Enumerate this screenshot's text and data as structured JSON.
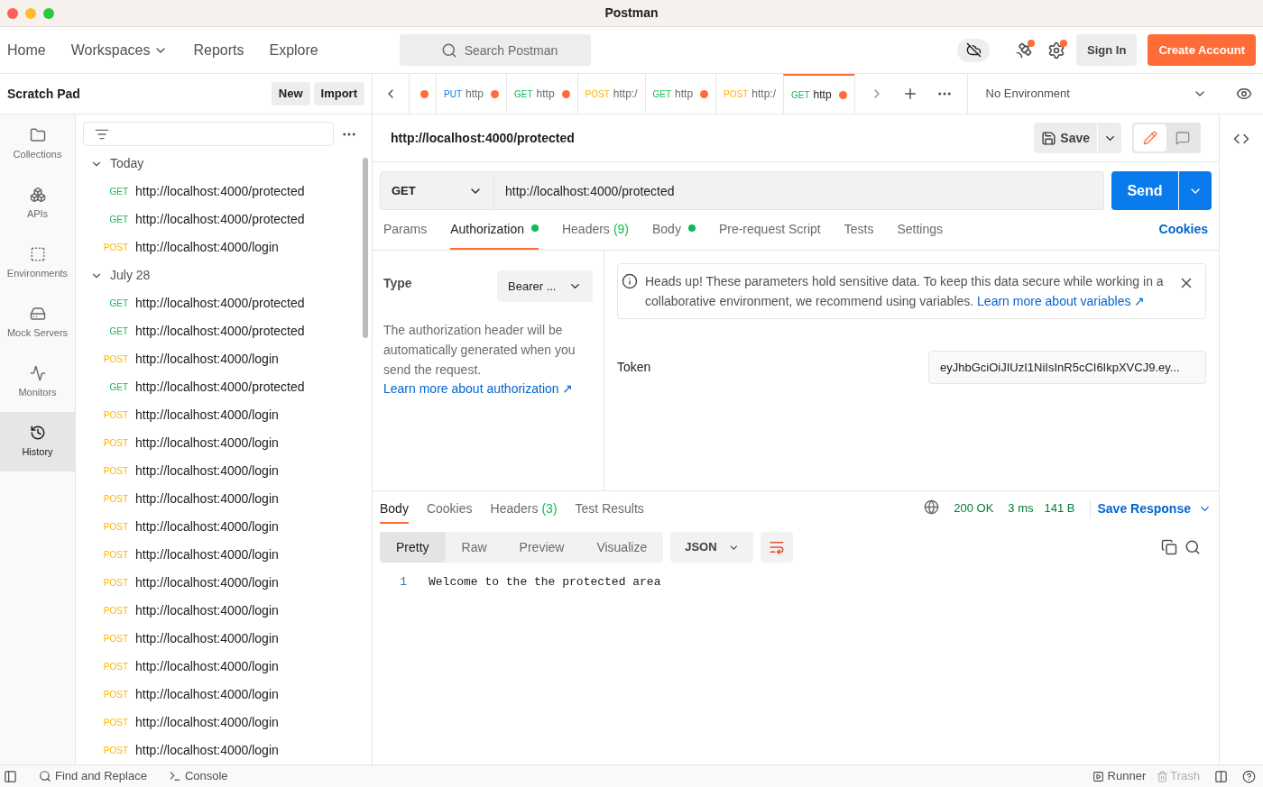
{
  "window": {
    "title": "Postman"
  },
  "nav": {
    "items": [
      {
        "label": "Home",
        "dropdown": false
      },
      {
        "label": "Workspaces",
        "dropdown": true
      },
      {
        "label": "Reports",
        "dropdown": false
      },
      {
        "label": "Explore",
        "dropdown": false
      }
    ],
    "search": {
      "placeholder": "Search Postman"
    },
    "sign_in": "Sign In",
    "create_account": "Create Account"
  },
  "scratch": {
    "title": "Scratch Pad",
    "buttons": [
      "New",
      "Import"
    ]
  },
  "rail": [
    {
      "label": "Collections",
      "kind": "collections",
      "selected": false
    },
    {
      "label": "APIs",
      "kind": "apis",
      "selected": false
    },
    {
      "label": "Environments",
      "kind": "environments",
      "selected": false
    },
    {
      "label": "Mock Servers",
      "kind": "mock",
      "selected": false
    },
    {
      "label": "Monitors",
      "kind": "monitors",
      "selected": false
    },
    {
      "label": "History",
      "kind": "history",
      "selected": true
    }
  ],
  "history": [
    {
      "label": "Today",
      "expanded": true,
      "children": [
        {
          "method": "GET",
          "color": "#0cbb52",
          "url": "http://localhost:4000/protected"
        },
        {
          "method": "GET",
          "color": "#0cbb52",
          "url": "http://localhost:4000/protected"
        },
        {
          "method": "POST",
          "color": "#ffb400",
          "url": "http://localhost:4000/login"
        }
      ]
    },
    {
      "label": "July 28",
      "expanded": true,
      "children": [
        {
          "method": "GET",
          "color": "#0cbb52",
          "url": "http://localhost:4000/protected"
        },
        {
          "method": "GET",
          "color": "#0cbb52",
          "url": "http://localhost:4000/protected"
        },
        {
          "method": "POST",
          "color": "#ffb400",
          "url": "http://localhost:4000/login"
        },
        {
          "method": "GET",
          "color": "#0cbb52",
          "url": "http://localhost:4000/protected"
        },
        {
          "method": "POST",
          "color": "#ffb400",
          "url": "http://localhost:4000/login"
        },
        {
          "method": "POST",
          "color": "#ffb400",
          "url": "http://localhost:4000/login"
        },
        {
          "method": "POST",
          "color": "#ffb400",
          "url": "http://localhost:4000/login"
        },
        {
          "method": "POST",
          "color": "#ffb400",
          "url": "http://localhost:4000/login"
        },
        {
          "method": "POST",
          "color": "#ffb400",
          "url": "http://localhost:4000/login"
        },
        {
          "method": "POST",
          "color": "#ffb400",
          "url": "http://localhost:4000/login"
        },
        {
          "method": "POST",
          "color": "#ffb400",
          "url": "http://localhost:4000/login"
        },
        {
          "method": "POST",
          "color": "#ffb400",
          "url": "http://localhost:4000/login"
        },
        {
          "method": "POST",
          "color": "#ffb400",
          "url": "http://localhost:4000/login"
        },
        {
          "method": "POST",
          "color": "#ffb400",
          "url": "http://localhost:4000/login"
        },
        {
          "method": "POST",
          "color": "#ffb400",
          "url": "http://localhost:4000/login"
        },
        {
          "method": "POST",
          "color": "#ffb400",
          "url": "http://localhost:4000/login"
        },
        {
          "method": "POST",
          "color": "#ffb400",
          "url": "http://localhost:4000/login"
        }
      ]
    }
  ],
  "tabs": [
    {
      "unsaved": true,
      "selected": false
    },
    {
      "method": "PUT",
      "color": "#097bed",
      "label": "http",
      "unsaved": true,
      "selected": false
    },
    {
      "method": "GET",
      "color": "#0cbb52",
      "label": "http",
      "unsaved": true,
      "selected": false
    },
    {
      "method": "POST",
      "color": "#ffb400",
      "label": "http:/",
      "unsaved": false,
      "selected": false
    },
    {
      "method": "GET",
      "color": "#0cbb52",
      "label": "http",
      "unsaved": true,
      "selected": false
    },
    {
      "method": "POST",
      "color": "#ffb400",
      "label": "http:/",
      "unsaved": false,
      "selected": false
    },
    {
      "method": "GET",
      "color": "#0cbb52",
      "label": "http",
      "unsaved": true,
      "selected": true
    }
  ],
  "environment": "No Environment",
  "request": {
    "title": "http://localhost:4000/protected",
    "save": "Save",
    "modes": [
      {
        "kind": "edit",
        "selected": true
      },
      {
        "kind": "comment",
        "selected": false
      }
    ],
    "method": "GET",
    "url": "http://localhost:4000/protected",
    "send": "Send",
    "tabs": [
      {
        "label": "Params",
        "selected": false
      },
      {
        "label": "Authorization",
        "dot": true,
        "selected": true
      },
      {
        "label": "Headers",
        "count": "(9)",
        "selected": false
      },
      {
        "label": "Body",
        "dot": true,
        "selected": false
      },
      {
        "label": "Pre-request Script",
        "selected": false
      },
      {
        "label": "Tests",
        "selected": false
      },
      {
        "label": "Settings",
        "selected": false
      }
    ],
    "cookies": "Cookies"
  },
  "auth": {
    "type_label": "Type",
    "type_value": "Bearer ...",
    "description": "The authorization header will be automatically generated when you send the request.",
    "learn_more": "Learn more about authorization ↗",
    "notice": "Heads up! These parameters hold sensitive data. To keep this data secure while working in a collaborative environment, we recommend using variables.",
    "notice_link": "Learn more about variables ↗",
    "token_label": "Token",
    "token_value": "eyJhbGciOiJIUzI1NiIsInR5cCI6IkpXVCJ9.ey..."
  },
  "response": {
    "tabs": [
      {
        "label": "Body",
        "selected": true
      },
      {
        "label": "Cookies",
        "selected": false
      },
      {
        "label": "Headers",
        "count": "(3)",
        "selected": false
      },
      {
        "label": "Test Results",
        "selected": false
      }
    ],
    "status": "200 OK",
    "time": "3 ms",
    "size": "141 B",
    "save_response": "Save Response",
    "views": [
      {
        "label": "Pretty",
        "selected": true
      },
      {
        "label": "Raw",
        "selected": false
      },
      {
        "label": "Preview",
        "selected": false
      },
      {
        "label": "Visualize",
        "selected": false
      }
    ],
    "format": "JSON",
    "lines": [
      {
        "number": "1",
        "text": "Welcome to the the protected area"
      }
    ]
  },
  "status_bar": {
    "left": [
      "Find and Replace",
      "Console"
    ],
    "runner": "Runner",
    "trash": "Trash"
  }
}
